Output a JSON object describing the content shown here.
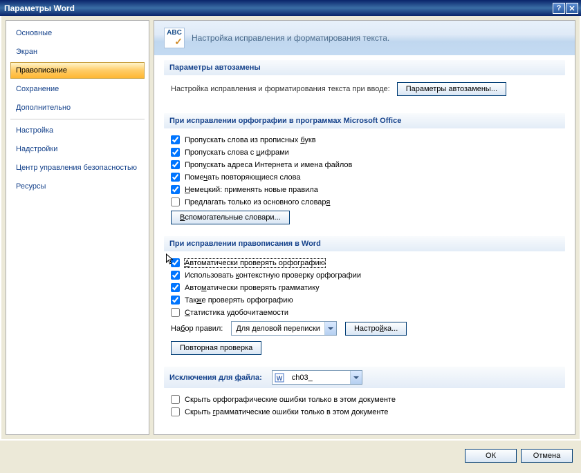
{
  "title": "Параметры Word",
  "sidebar": {
    "groups": [
      [
        "Основные",
        "Экран",
        "Правописание",
        "Сохранение",
        "Дополнительно"
      ],
      [
        "Настройка",
        "Надстройки",
        "Центр управления безопасностью",
        "Ресурсы"
      ]
    ],
    "selected": "Правописание"
  },
  "header": {
    "icon_text": "ABC",
    "text": "Настройка исправления и форматирования текста."
  },
  "section_autocorrect": {
    "title": "Параметры автозамены",
    "desc": "Настройка исправления и форматирования текста при вводе:",
    "button": "Параметры автозамены..."
  },
  "section_office": {
    "title": "При исправлении орфографии в программах Microsoft Office",
    "checks": [
      {
        "pre": "Пропускать слова из прописных ",
        "u": "б",
        "post": "укв",
        "checked": true
      },
      {
        "pre": "Пропускать слова с ",
        "u": "ц",
        "post": "ифрами",
        "checked": true
      },
      {
        "pre": "Проп",
        "u": "у",
        "post": "скать адреса Интернета и имена файлов",
        "checked": true
      },
      {
        "pre": "Поме",
        "u": "ч",
        "post": "ать повторяющиеся слова",
        "checked": true
      },
      {
        "pre": "",
        "u": "Н",
        "post": "емецкий: применять новые правила",
        "checked": true
      },
      {
        "pre": "Предлагать только из основного словар",
        "u": "я",
        "post": "",
        "checked": false
      }
    ],
    "button": "Вспомогательные словари..."
  },
  "section_word": {
    "title": "При исправлении правописания в Word",
    "checks": [
      {
        "pre": "",
        "u": "А",
        "post": "втоматически проверять орфографию",
        "checked": true,
        "focused": true
      },
      {
        "pre": "Использовать ",
        "u": "к",
        "post": "онтекстную проверку орфографии",
        "checked": true
      },
      {
        "pre": "Авто",
        "u": "м",
        "post": "атически проверять грамматику",
        "checked": true
      },
      {
        "pre": "Так",
        "u": "ж",
        "post": "е проверять орфографию",
        "checked": true
      },
      {
        "pre": "",
        "u": "С",
        "post": "татистика удобочитаемости",
        "checked": false
      }
    ],
    "ruleset_label": "На<u>б</u>ор правил:",
    "ruleset_label_pre": "На",
    "ruleset_label_u": "б",
    "ruleset_label_post": "ор правил:",
    "ruleset_value": "Для деловой переписки",
    "settings_button": "Настро<u>й</u>ка...",
    "settings_pre": "Настро",
    "settings_u": "й",
    "settings_post": "ка...",
    "recheck_button": "Повторная проверка"
  },
  "section_exceptions": {
    "title_pre": "Исключения для ",
    "title_u": "ф",
    "title_post": "айла:",
    "file_value": "ch03_",
    "checks": [
      {
        "pre": "Скрыть орфографические ошибки только в этом ",
        "u": "д",
        "post": "окументе",
        "checked": false
      },
      {
        "pre": "Скрыть ",
        "u": "г",
        "post": "рамматические ошибки только в этом документе",
        "checked": false
      }
    ]
  },
  "footer": {
    "ok": "ОК",
    "cancel": "Отмена"
  }
}
